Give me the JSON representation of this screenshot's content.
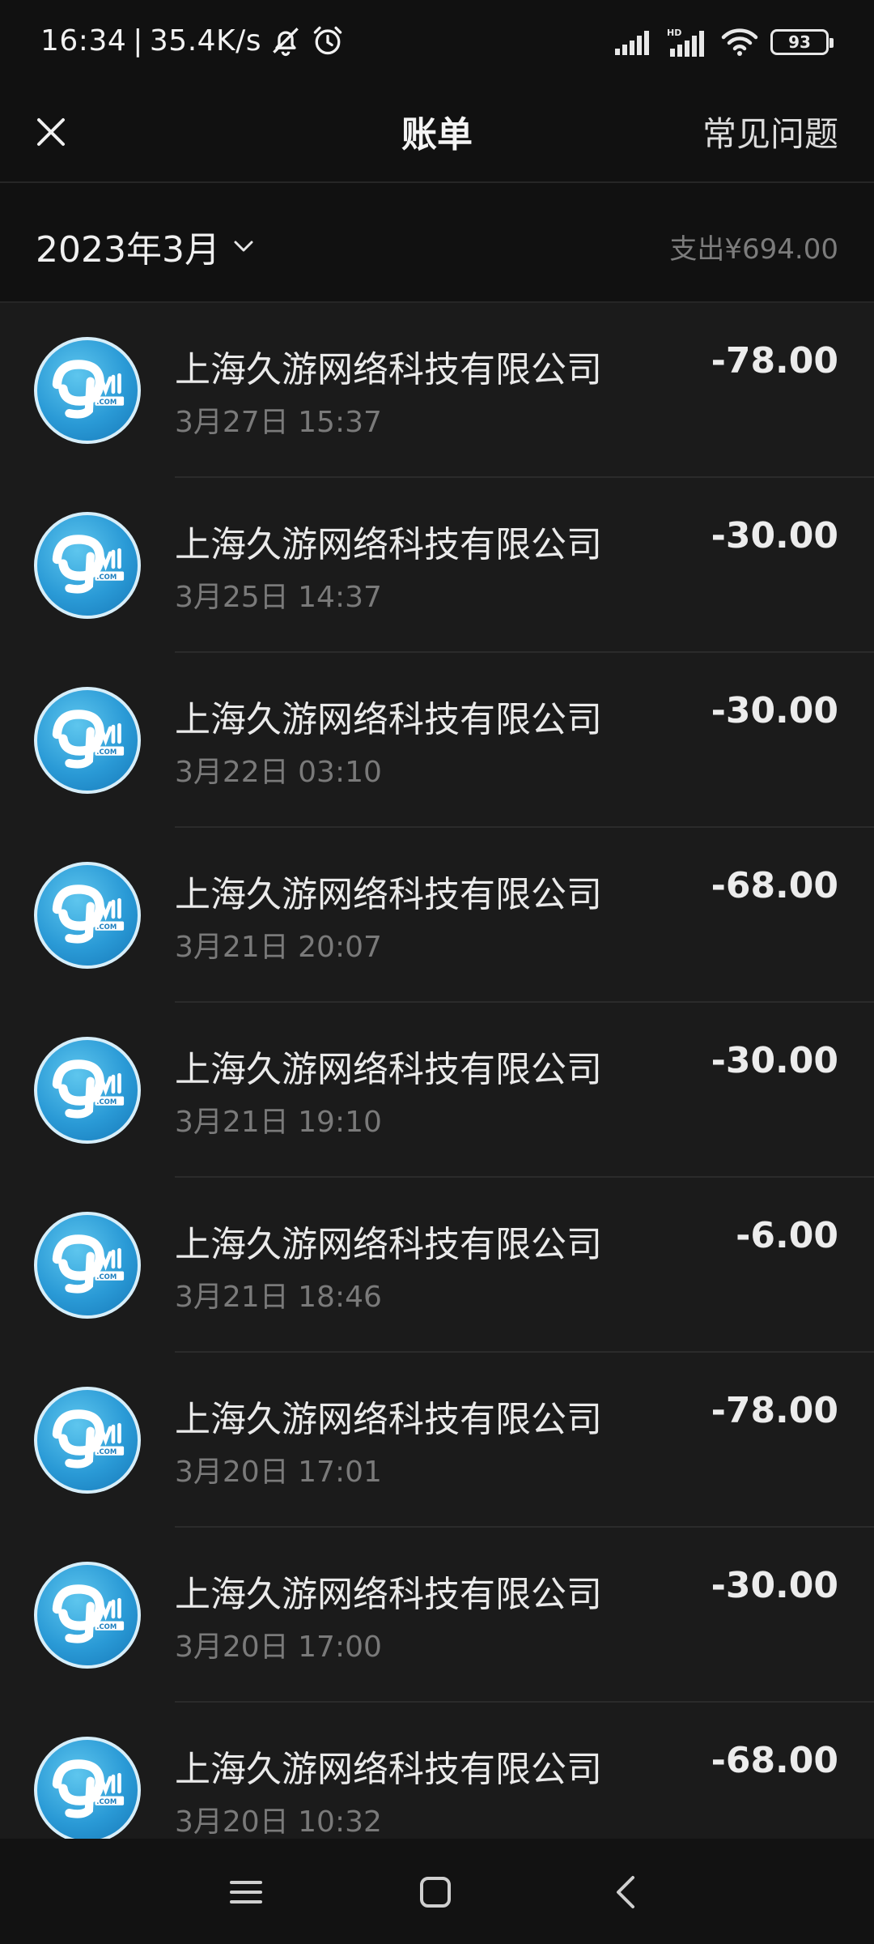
{
  "status_bar": {
    "time": "16:34",
    "separator": "|",
    "network_speed": "35.4K/s",
    "battery": "93",
    "icons": [
      "bell-off-icon",
      "alarm-icon",
      "signal-icon",
      "hd-signal-icon",
      "wifi-icon",
      "battery-icon"
    ]
  },
  "header": {
    "title": "账单",
    "faq_label": "常见问题",
    "close_icon": "close-icon"
  },
  "summary": {
    "month": "2023年3月",
    "expense": "支出¥694.00"
  },
  "bills": [
    {
      "merchant": "上海久游网络科技有限公司",
      "datetime": "3月27日 15:37",
      "amount": "-78.00"
    },
    {
      "merchant": "上海久游网络科技有限公司",
      "datetime": "3月25日 14:37",
      "amount": "-30.00"
    },
    {
      "merchant": "上海久游网络科技有限公司",
      "datetime": "3月22日 03:10",
      "amount": "-30.00"
    },
    {
      "merchant": "上海久游网络科技有限公司",
      "datetime": "3月21日 20:07",
      "amount": "-68.00"
    },
    {
      "merchant": "上海久游网络科技有限公司",
      "datetime": "3月21日 19:10",
      "amount": "-30.00"
    },
    {
      "merchant": "上海久游网络科技有限公司",
      "datetime": "3月21日 18:46",
      "amount": "-6.00"
    },
    {
      "merchant": "上海久游网络科技有限公司",
      "datetime": "3月20日 17:01",
      "amount": "-78.00"
    },
    {
      "merchant": "上海久游网络科技有限公司",
      "datetime": "3月20日 17:00",
      "amount": "-30.00"
    },
    {
      "merchant": "上海久游网络科技有限公司",
      "datetime": "3月20日 10:32",
      "amount": "-68.00"
    }
  ],
  "nav_bar": {
    "icons": [
      "menu-icon",
      "home-icon",
      "back-icon"
    ]
  }
}
